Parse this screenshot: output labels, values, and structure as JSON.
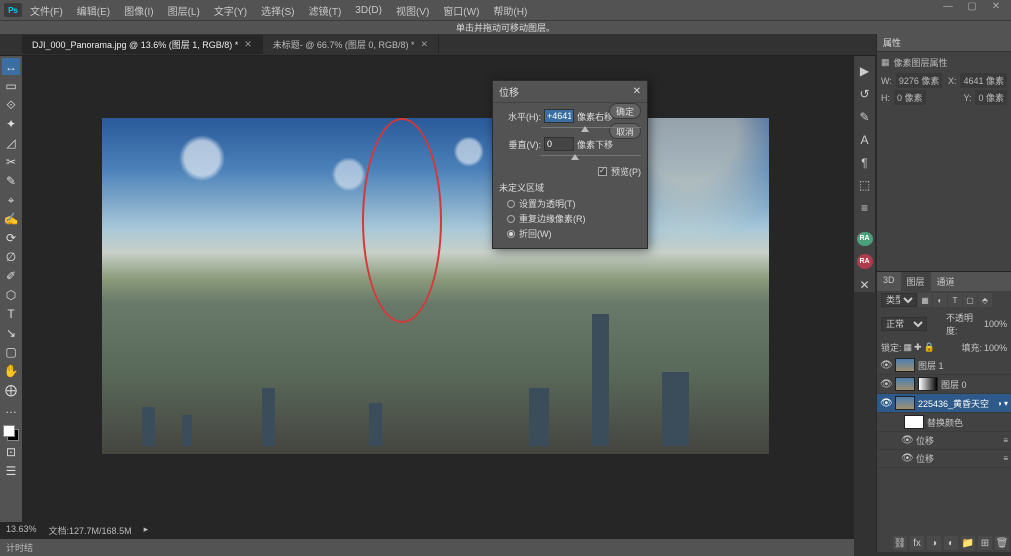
{
  "menubar": {
    "logo": "Ps",
    "items": [
      "文件(F)",
      "编辑(E)",
      "图像(I)",
      "图层(L)",
      "文字(Y)",
      "选择(S)",
      "滤镜(T)",
      "3D(D)",
      "视图(V)",
      "窗口(W)",
      "帮助(H)"
    ]
  },
  "optionsbar": {
    "text": "单击并拖动可移动图层。"
  },
  "tabs": [
    {
      "label": "DJI_000_Panorama.jpg @ 13.6% (图层 1, RGB/8) *",
      "active": true
    },
    {
      "label": "未标题- @ 66.7% (图层 0, RGB/8) *",
      "active": false
    }
  ],
  "tools": [
    "↔",
    "▭",
    "⟐",
    "✦",
    "◿",
    "✂",
    "✎",
    "⌖",
    "✍",
    "⟳",
    "∅",
    "✐",
    "⬡",
    "T",
    "↘",
    "▢",
    "✋",
    "⨁",
    "…",
    "⋯",
    "⊡",
    "☰",
    "⊟"
  ],
  "dialog": {
    "title": "位移",
    "horizontal_label": "水平(H):",
    "horizontal_value": "+4641",
    "horizontal_unit": "像素右移",
    "vertical_label": "垂直(V):",
    "vertical_value": "0",
    "vertical_unit": "像素下移",
    "undefined_label": "未定义区域",
    "opt1": "设置为透明(T)",
    "opt2": "重复边缘像素(R)",
    "opt3": "折回(W)",
    "preview": "预览(P)",
    "ok": "确定",
    "cancel": "取消"
  },
  "rightcol_bottom": {
    "ra1": "RA",
    "ra2": "RA"
  },
  "panels": {
    "props_tab": "属性",
    "props_hint": "像素图层属性",
    "w_label": "W:",
    "w_val": "9276 像素",
    "x_label": "X:",
    "x_val": "4641 像素",
    "h_label": "H:",
    "h_val": "0 像素",
    "y_label": "Y:",
    "y_val": "0 像素"
  },
  "layers": {
    "tabs": [
      "3D",
      "图层",
      "通道"
    ],
    "type": "类型",
    "mode": "正常",
    "opacity_label": "不透明度:",
    "opacity": "100%",
    "lock_label": "锁定:",
    "fill_label": "填充:",
    "fill": "100%",
    "items": [
      {
        "name": "图层 1",
        "visible": true
      },
      {
        "name": "图层 0",
        "visible": true,
        "linked": true
      },
      {
        "name": "225436_黄昏天空",
        "visible": true,
        "active": true
      },
      {
        "name": "替换颜色",
        "indent": 1
      },
      {
        "name": "位移",
        "indent": 2
      },
      {
        "name": "位移",
        "indent": 2
      }
    ]
  },
  "status": {
    "zoom": "13.63%",
    "docinfo": "文档:127.7M/168.5M",
    "hint": "计时结"
  },
  "chart_data": null
}
